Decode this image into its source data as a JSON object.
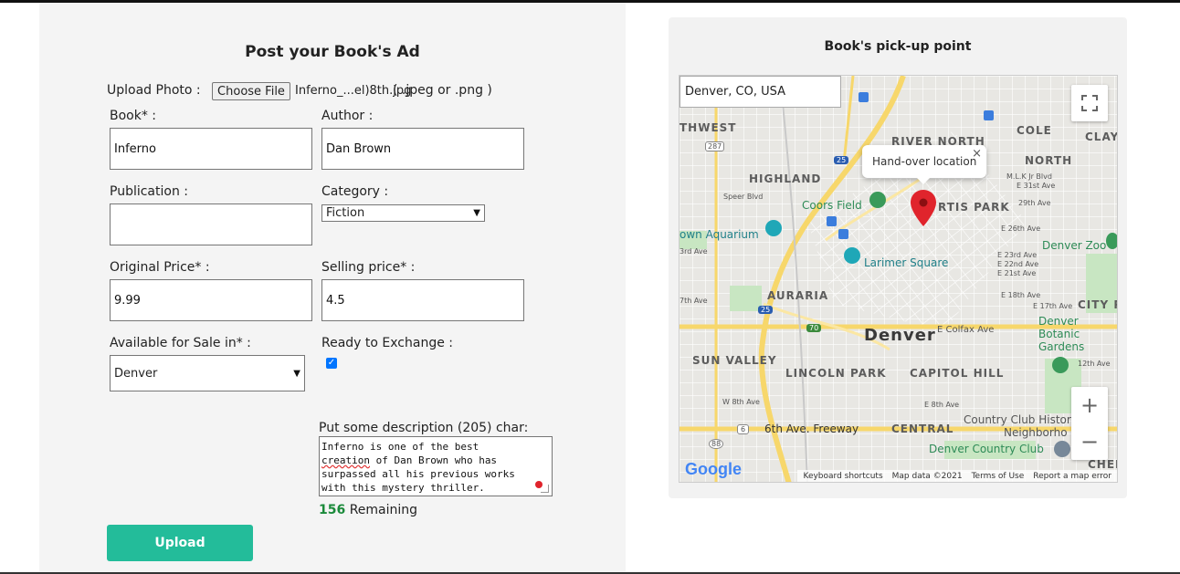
{
  "form": {
    "title": "Post your Book's Ad",
    "upload_photo_label": "Upload Photo :",
    "choose_file_button": "Choose File",
    "file_name": "Inferno_...el)8th.jpg",
    "file_hint": "( .jpeg or .png )",
    "book_label": "Book* :",
    "book_value": "Inferno",
    "author_label": "Author :",
    "author_value": "Dan Brown",
    "publication_label": "Publication :",
    "publication_value": "",
    "category_label": "Category :",
    "category_value": "Fiction",
    "original_price_label": "Original Price* :",
    "original_price_value": "9.99",
    "selling_price_label": "Selling price* :",
    "selling_price_value": "4.5",
    "available_label": "Available for Sale in* :",
    "available_value": "Denver",
    "exchange_label": "Ready to Exchange :",
    "exchange_checked": true,
    "description_label": "Put some description (205) char:",
    "description_value_before": "Inferno is one of the best\n",
    "description_spell": "creation",
    "description_value_after": " of Dan Brown who has\nsurpassed all his previous works\nwith this mystery thriller.",
    "remaining_count": "156",
    "remaining_label": "Remaining",
    "upload_button": "Upload"
  },
  "map": {
    "title": "Book's pick-up point",
    "search_value": "Denver, CO, USA",
    "popup_text": "Hand-over location",
    "popup_close": "×",
    "zoom_in": "+",
    "zoom_out": "−",
    "google_logo": "Google",
    "footer": {
      "shortcuts": "Keyboard shortcuts",
      "map_data": "Map data ©2021",
      "terms": "Terms of Use",
      "report": "Report a map error"
    },
    "labels": {
      "northwest": "THWEST",
      "highland": "HIGHLAND",
      "river_north": "RIVER NORTH",
      "cole": "COLE",
      "clay": "CLAY",
      "north": "NORTH",
      "curtis_park": "RTIS PARK",
      "coors_field": "Coors Field",
      "aquarium": "own Aquarium",
      "larimer": "Larimer Square",
      "denver_zoo": "Denver Zoo",
      "auraria": "AURARIA",
      "city_park": "CITY P",
      "denver": "Denver",
      "colfax": "E Colfax Ave",
      "botanic": "Denver\nBotanic\nGardens",
      "sun_valley": "SUN VALLEY",
      "lincoln_park": "LINCOLN PARK",
      "capitol_hill": "CAPITOL HILL",
      "central": "CENTRAL",
      "sixth_ave": "6th Ave. Freeway",
      "country_club_hist": "Country Club Histor",
      "neighborhood": "Neighborho",
      "country_club": "Denver Country Club",
      "cherry": "CHERR",
      "twenty_ninth": "29th Ave",
      "e_26th": "E 26th Ave",
      "e_23rd": "E 23rd Ave",
      "e_22nd": "E 22nd Ave",
      "e_21st": "E 21st Ave",
      "e_18th": "E 18th Ave",
      "e_17th": "E 17th Ave",
      "w_8th": "W 8th Ave",
      "e_8th": "E 8th Ave",
      "twelfth": "12th Ave",
      "mlk": "M.L.K Jr Blvd",
      "e_31st": "E 31st Ave",
      "third_ave": "3rd Ave",
      "seventh_ave": "7th Ave",
      "speer_blvd": "Speer Blvd",
      "route_287": "287",
      "route_25a": "25",
      "route_25b": "25",
      "route_70": "70",
      "route_6": "6",
      "route_88": "88"
    }
  },
  "colors": {
    "upload_button": "#23bc9a",
    "checkbox": "#0075ff",
    "pin": "#e0242c",
    "remaining_count": "#1a8a3a",
    "park_green": "#c8e6c2",
    "highway_yellow": "#f7d76b"
  }
}
